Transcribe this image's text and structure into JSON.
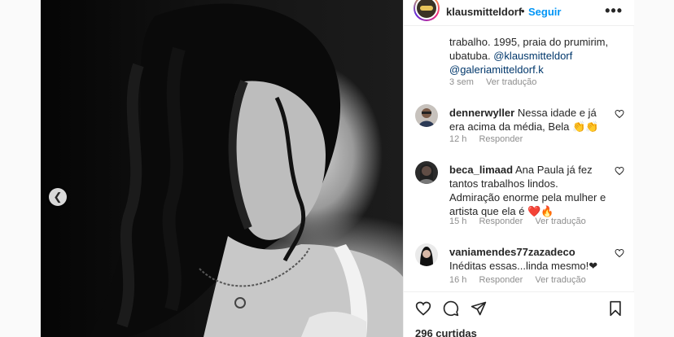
{
  "post": {
    "username": "klausmitteldorf",
    "separator": "•",
    "follow_label": "Seguir",
    "more_label": "•••",
    "caption_text": "trabalho. 1995, praia do prumirim, ubatuba.",
    "caption_mention_1": "@klausmitteldorf",
    "caption_mention_2": "@galeriamitteldorf.k",
    "caption_time": "3 sem",
    "caption_translate": "Ver tradução",
    "likes": "296 curtidas"
  },
  "comments": [
    {
      "user": "dennerwyller",
      "text": "Nessa idade e já era acima da média, Bela 👏👏",
      "time": "12 h",
      "reply": "Responder",
      "translate": ""
    },
    {
      "user": "beca_limaad",
      "text": "Ana Paula já fez tantos trabalhos lindos. Admiração enorme pela mulher e artista que ela é ❤️🔥",
      "time": "15 h",
      "reply": "Responder",
      "translate": "Ver tradução"
    },
    {
      "user": "vaniamendes77zazadeco",
      "text": "Inéditas essas...linda mesmo!❤",
      "time": "16 h",
      "reply": "Responder",
      "translate": "Ver tradução"
    }
  ],
  "icons": {
    "prev": "chevron-left-icon",
    "like": "heart-icon",
    "comment": "comment-icon",
    "share": "send-icon",
    "save": "bookmark-icon"
  },
  "colors": {
    "accent": "#0095f6",
    "mention": "#00376b",
    "muted": "#8e8e8e"
  }
}
